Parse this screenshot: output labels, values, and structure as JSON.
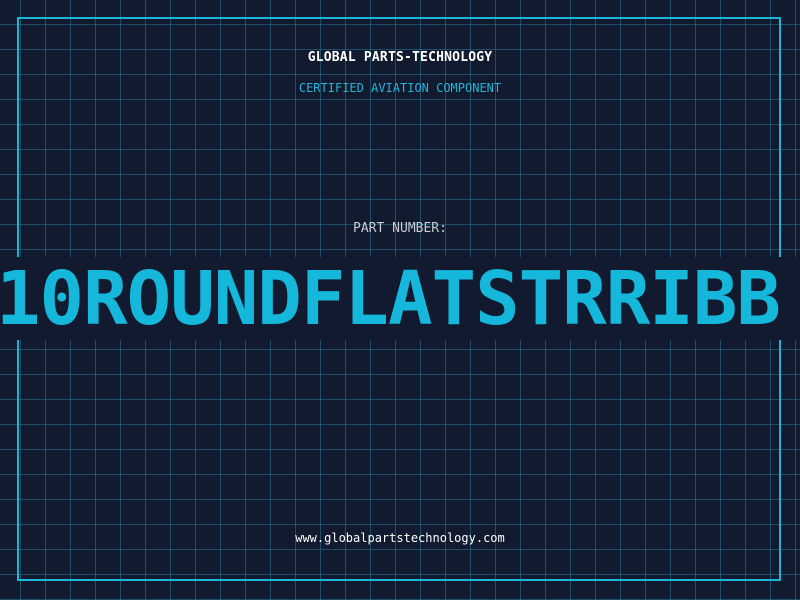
{
  "header": {
    "company": "GLOBAL PARTS-TECHNOLOGY",
    "tagline": "CERTIFIED AVIATION COMPONENT"
  },
  "part": {
    "label": "PART NUMBER:",
    "number": "10ROUNDFLATSTRRIBB"
  },
  "footer": {
    "website": "www.globalpartstechnology.com"
  },
  "colors": {
    "background": "#111a2e",
    "accent": "#15b7da",
    "grid": "#287896"
  }
}
